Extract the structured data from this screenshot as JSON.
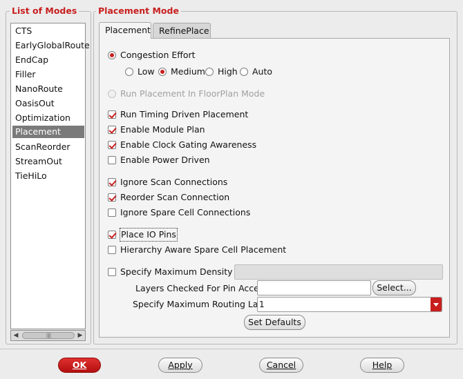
{
  "modes_panel": {
    "title": "List of Modes",
    "items": [
      "CTS",
      "EarlyGlobalRoute",
      "EndCap",
      "Filler",
      "NanoRoute",
      "OasisOut",
      "Optimization",
      "Placement",
      "ScanReorder",
      "StreamOut",
      "TieHiLo"
    ],
    "selected": "Placement"
  },
  "placement_panel": {
    "title": "Placement Mode",
    "tabs": [
      {
        "label": "Placement",
        "active": true
      },
      {
        "label": "RefinePlace",
        "active": false
      }
    ]
  },
  "congestion": {
    "label": "Congestion Effort",
    "options": [
      "Low",
      "Medium",
      "High",
      "Auto"
    ],
    "selected": "Medium"
  },
  "floorplan_mode": {
    "label": "Run Placement In FloorPlan Mode",
    "enabled": false
  },
  "options": {
    "timing_driven": {
      "label": "Run Timing Driven Placement",
      "checked": true
    },
    "module_plan": {
      "label": "Enable Module Plan",
      "checked": true
    },
    "clock_gating": {
      "label": "Enable Clock Gating Awareness",
      "checked": true
    },
    "power_driven": {
      "label": "Enable Power Driven",
      "checked": false
    },
    "ignore_scan": {
      "label": "Ignore Scan Connections",
      "checked": true
    },
    "reorder_scan": {
      "label": "Reorder Scan Connection",
      "checked": true
    },
    "ignore_spare": {
      "label": "Ignore Spare Cell Connections",
      "checked": false
    },
    "place_io": {
      "label": "Place IO Pins",
      "checked": true
    },
    "hierarchy_spare": {
      "label": "Hierarchy Aware Spare Cell Placement",
      "checked": false
    },
    "max_density": {
      "label": "Specify Maximum Density",
      "checked": false,
      "value": ""
    }
  },
  "pin_access": {
    "label": "Layers Checked For Pin Access",
    "value": "",
    "select_label": "Select..."
  },
  "routing_layer": {
    "label": "Specify Maximum Routing Layer",
    "value": "1"
  },
  "set_defaults_label": "Set Defaults",
  "footer": {
    "ok": "OK",
    "apply": "Apply",
    "cancel": "Cancel",
    "help": "Help"
  },
  "colors": {
    "accent": "#c81e1e",
    "selection": "#7a7a7a"
  }
}
